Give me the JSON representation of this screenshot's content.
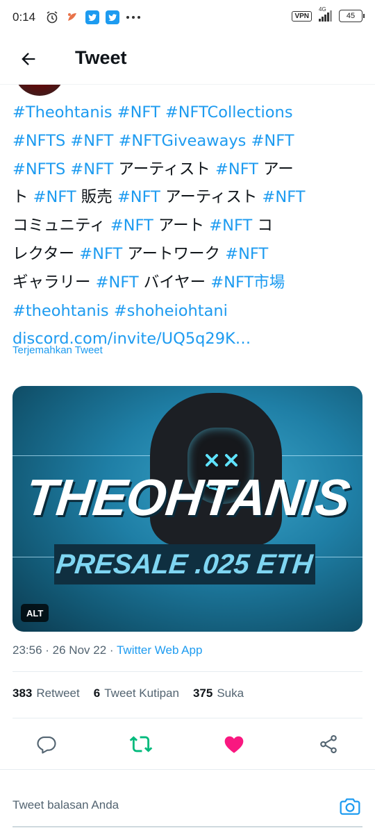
{
  "status_bar": {
    "time": "0:14",
    "vpn_label": "VPN",
    "network_label": "4G",
    "battery_level": "45"
  },
  "header": {
    "title": "Tweet"
  },
  "tweet": {
    "lines": [
      [
        {
          "t": "#Theohtanis",
          "tag": true
        },
        {
          "t": " "
        },
        {
          "t": "#NFT",
          "tag": true
        },
        {
          "t": " "
        },
        {
          "t": "#NFTCollections",
          "tag": true
        }
      ],
      [
        {
          "t": "#NFTS",
          "tag": true
        },
        {
          "t": " "
        },
        {
          "t": "#NFT",
          "tag": true
        },
        {
          "t": " "
        },
        {
          "t": "#NFTGiveaways",
          "tag": true
        },
        {
          "t": " "
        },
        {
          "t": "#NFT",
          "tag": true
        }
      ],
      [
        {
          "t": "#NFTS",
          "tag": true
        },
        {
          "t": " "
        },
        {
          "t": "#NFT",
          "tag": true
        },
        {
          "t": " アーティスト "
        },
        {
          "t": "#NFT",
          "tag": true
        },
        {
          "t": " アー"
        }
      ],
      [
        {
          "t": "ト "
        },
        {
          "t": "#NFT",
          "tag": true
        },
        {
          "t": " 販売 "
        },
        {
          "t": "#NFT",
          "tag": true
        },
        {
          "t": " アーティスト "
        },
        {
          "t": "#NFT",
          "tag": true
        }
      ],
      [
        {
          "t": "コミュニティ "
        },
        {
          "t": "#NFT",
          "tag": true
        },
        {
          "t": " アート "
        },
        {
          "t": "#NFT",
          "tag": true
        },
        {
          "t": " コ"
        }
      ],
      [
        {
          "t": "レクター "
        },
        {
          "t": "#NFT",
          "tag": true
        },
        {
          "t": " アートワーク "
        },
        {
          "t": "#NFT",
          "tag": true
        }
      ],
      [
        {
          "t": "ギャラリー "
        },
        {
          "t": "#NFT",
          "tag": true
        },
        {
          "t": " バイヤー "
        },
        {
          "t": "#NFT市場",
          "tag": true
        }
      ],
      [
        {
          "t": "#theohtanis",
          "tag": true
        },
        {
          "t": " "
        },
        {
          "t": "#shoheiohtani",
          "tag": true
        }
      ],
      [
        {
          "t": "discord.com/invite/UQ5q29K…",
          "tag": true
        }
      ]
    ],
    "translate_label": "Terjemahkan Tweet"
  },
  "media": {
    "title": "THEOHTANIS",
    "subtitle": "PRESALE .025 ETH",
    "alt_badge": "ALT"
  },
  "meta": {
    "time": "23:56",
    "separator": " · ",
    "date": "26 Nov 22",
    "source": "Twitter Web App"
  },
  "stats": {
    "retweets_count": "383",
    "retweets_label": "Retweet",
    "quotes_count": "6",
    "quotes_label": "Tweet Kutipan",
    "likes_count": "375",
    "likes_label": "Suka"
  },
  "actions": {
    "reply_icon": "comment-icon",
    "retweet_icon": "retweet-icon",
    "like_icon": "heart-icon",
    "share_icon": "share-icon"
  },
  "reply": {
    "placeholder": "Tweet balasan Anda"
  },
  "colors": {
    "accent": "#1d9bf0",
    "retweet": "#00ba7c",
    "like": "#f91880",
    "muted": "#536471",
    "text": "#0f1419"
  }
}
